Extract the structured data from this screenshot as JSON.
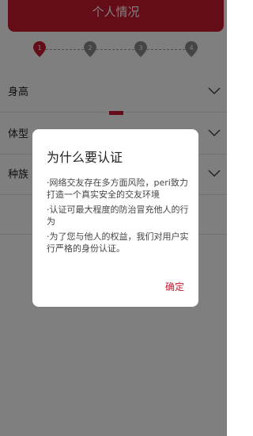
{
  "header": {
    "title": "个人情况"
  },
  "steps": [
    {
      "label": "1",
      "active": true
    },
    {
      "label": "2",
      "active": false
    },
    {
      "label": "3",
      "active": false
    },
    {
      "label": "4",
      "active": false
    }
  ],
  "form": {
    "rows": [
      {
        "label": "身高"
      },
      {
        "label": "体型"
      },
      {
        "label": "种族"
      }
    ]
  },
  "dialog": {
    "title": "为什么要认证",
    "paragraphs": [
      "·网络交友存在多方面风险，peri致力打造一个真实安全的交友环境",
      "·认证可最大程度的防治冒充他人的行为",
      "·为了您与他人的权益，我们对用户实行严格的身份认证。"
    ],
    "confirm_label": "确定"
  },
  "colors": {
    "accent": "#c8192f",
    "step_inactive": "#8a8a8a",
    "overlay": "rgba(0,0,0,0.5)"
  }
}
